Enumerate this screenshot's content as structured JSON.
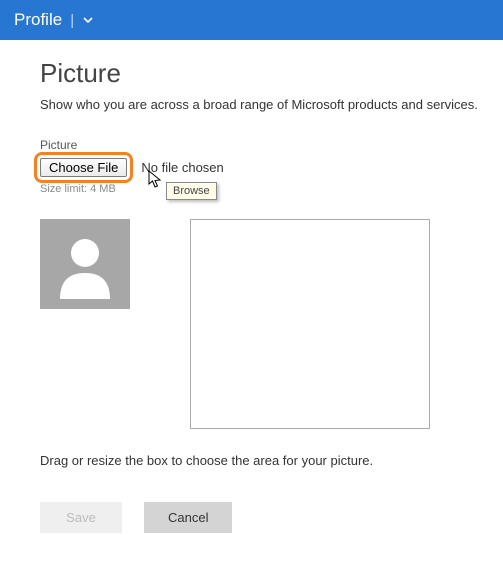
{
  "header": {
    "title": "Profile"
  },
  "page": {
    "heading": "Picture",
    "description": "Show who you are across a broad range of Microsoft products and services."
  },
  "picture_field": {
    "label": "Picture",
    "choose_button": "Choose File",
    "file_status": "No file chosen",
    "size_limit": "Size limit: 4 MB",
    "tooltip": "Browse"
  },
  "help_text": "Drag or resize the box to choose the area for your picture.",
  "buttons": {
    "save": "Save",
    "cancel": "Cancel"
  }
}
